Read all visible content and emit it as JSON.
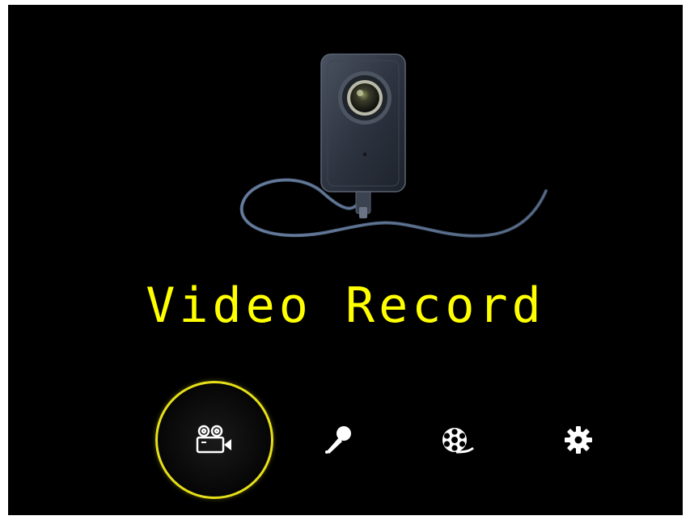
{
  "screen": {
    "title": "Video Record",
    "title_color": "#ffff00",
    "background_color": "#000000",
    "accent_color": "#e6e01a"
  },
  "illustration": {
    "icon": "body-camera-illustration"
  },
  "menu": {
    "selected_index": 0,
    "items": [
      {
        "id": "video-record",
        "icon": "video-camera-icon",
        "selected": true
      },
      {
        "id": "audio-record",
        "icon": "microphone-icon",
        "selected": false
      },
      {
        "id": "playback",
        "icon": "film-reel-icon",
        "selected": false
      },
      {
        "id": "settings",
        "icon": "gear-icon",
        "selected": false
      }
    ]
  }
}
